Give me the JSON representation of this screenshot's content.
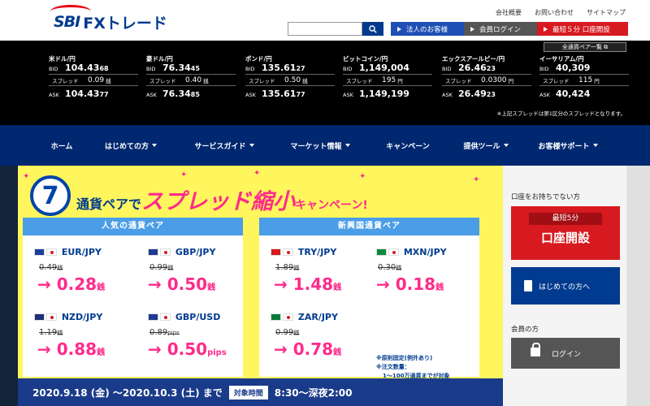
{
  "header": {
    "logo_sbi": "SBI",
    "logo_fx": "FXトレード",
    "links": [
      "会社概要",
      "お問い合わせ",
      "サイトマップ"
    ],
    "corp_label": "法人のお客様",
    "login_label": "会員ログイン",
    "open_label": "最短５分 口座開設"
  },
  "rates": {
    "all_rates_label": "全通貨ペア一覧",
    "note": "※上記スプレッドは第1区分のスプレッドとなります。",
    "bid_label": "BID",
    "ask_label": "ASK",
    "spread_label": "スプレッド",
    "items": [
      {
        "name": "米ドル/円",
        "bid_main": "104.43",
        "bid_sub": "68",
        "spread": "0.09",
        "spread_unit": "銭",
        "ask_main": "104.43",
        "ask_sub": "77"
      },
      {
        "name": "豪ドル/円",
        "bid_main": "76.34",
        "bid_sub": "45",
        "spread": "0.40",
        "spread_unit": "銭",
        "ask_main": "76.34",
        "ask_sub": "85"
      },
      {
        "name": "ポンド/円",
        "bid_main": "135.61",
        "bid_sub": "27",
        "spread": "0.50",
        "spread_unit": "銭",
        "ask_main": "135.61",
        "ask_sub": "77"
      },
      {
        "name": "ビットコイン/円",
        "bid_main": "1,149,004",
        "bid_sub": "",
        "spread": "195",
        "spread_unit": "円",
        "ask_main": "1,149,199",
        "ask_sub": ""
      },
      {
        "name": "エックスアールピー/円",
        "bid_main": "26.46",
        "bid_sub": "23",
        "spread": "0.0300",
        "spread_unit": "円",
        "ask_main": "26.49",
        "ask_sub": "23"
      },
      {
        "name": "イーサリアム/円",
        "bid_main": "40,309",
        "bid_sub": "",
        "spread": "115",
        "spread_unit": "円",
        "ask_main": "40,424",
        "ask_sub": ""
      }
    ]
  },
  "nav": [
    {
      "label": "ホーム",
      "caret": false
    },
    {
      "label": "はじめての方",
      "caret": true
    },
    {
      "label": "サービスガイド",
      "caret": true
    },
    {
      "label": "マーケット情報",
      "caret": true
    },
    {
      "label": "キャンペーン",
      "caret": false
    },
    {
      "label": "提供ツール",
      "caret": true
    },
    {
      "label": "お客様サポート",
      "caret": true
    }
  ],
  "banner": {
    "number": "7",
    "headline_a": "通貨ペアで",
    "headline_b": "スプレッド縮小",
    "headline_c": "キャンペーン!",
    "left_title": "人気の通貨ペア",
    "right_title": "新興国通貨ペア",
    "left_pairs": [
      {
        "name": "EUR/JPY",
        "old": "0.49",
        "old_unit": "銭",
        "new": "→ 0.28",
        "new_unit": "銭"
      },
      {
        "name": "GBP/JPY",
        "old": "0.99",
        "old_unit": "銭",
        "new": "→ 0.50",
        "new_unit": "銭"
      },
      {
        "name": "NZD/JPY",
        "old": "1.19",
        "old_unit": "銭",
        "new": "→ 0.88",
        "new_unit": "銭"
      },
      {
        "name": "GBP/USD",
        "old": "0.89",
        "old_unit": "pips",
        "new": "→ 0.50",
        "new_unit": "pips"
      }
    ],
    "right_pairs": [
      {
        "name": "TRY/JPY",
        "old": "1.89",
        "old_unit": "銭",
        "new": "→ 1.48",
        "new_unit": "銭"
      },
      {
        "name": "MXN/JPY",
        "old": "0.30",
        "old_unit": "銭",
        "new": "→ 0.18",
        "new_unit": "銭"
      },
      {
        "name": "ZAR/JPY",
        "old": "0.99",
        "old_unit": "銭",
        "new": "→ 0.78",
        "new_unit": "銭"
      }
    ],
    "note1": "※原則固定(例外あり)",
    "note2": "※注文数量：",
    "note3": "1〜100万通貨までが対象",
    "period": "2020.9.18 (金) 〜2020.10.3 (土) まで",
    "time_tag": "対象時間",
    "time": "8:30〜深夜2:00"
  },
  "sidebar": {
    "no_account": "口座をお持ちでない方",
    "open_top": "最短5分",
    "open_main": "口座開設",
    "first_time": "はじめての方へ",
    "member": "会員の方",
    "login": "ログイン"
  },
  "colors": {
    "brand": "#003b8f",
    "accent": "#d71920",
    "pink": "#ff2b8a",
    "banner": "#fff65d",
    "nav": "#002870"
  }
}
